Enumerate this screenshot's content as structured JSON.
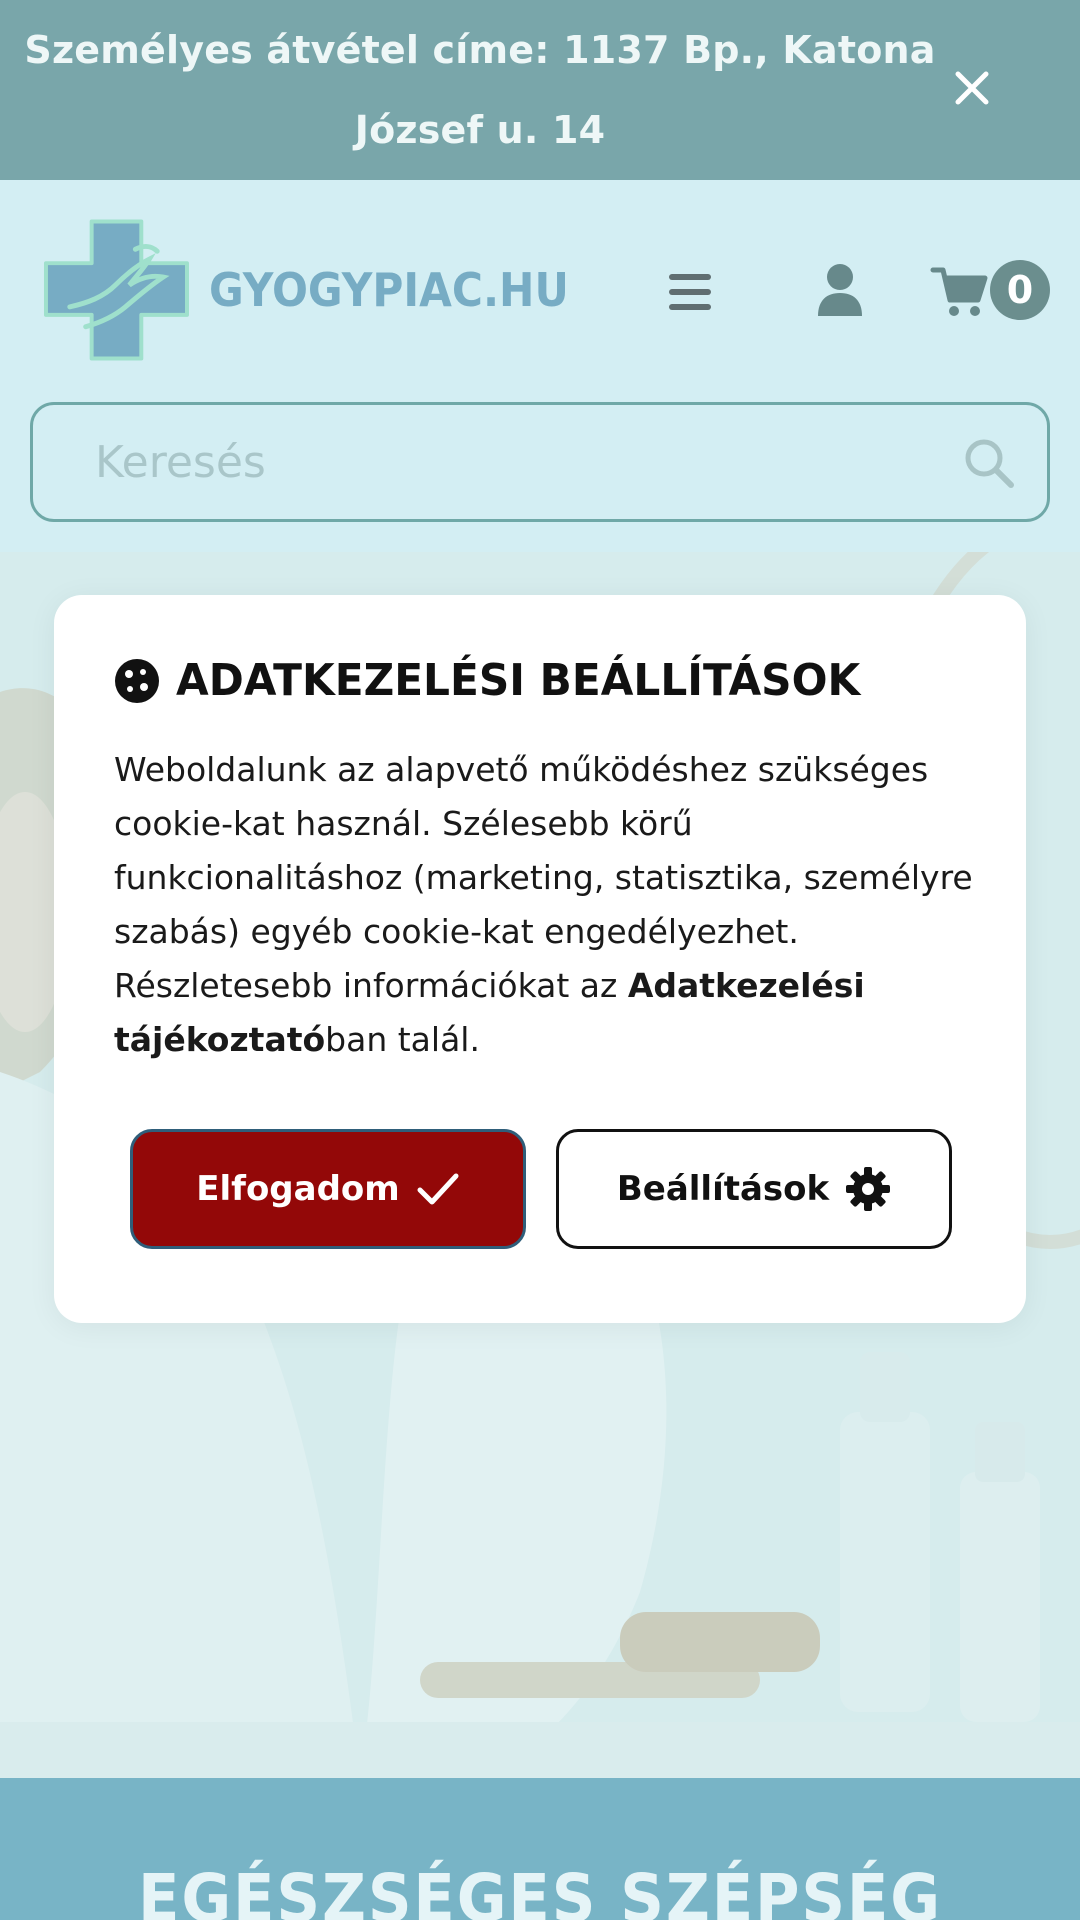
{
  "announcement": {
    "text": "Személyes átvétel címe: 1137 Bp., Katona József u. 14"
  },
  "header": {
    "logo_text": "GYOGYPIAC.HU",
    "cart_count": "0"
  },
  "search": {
    "placeholder": "Keresés"
  },
  "cookie_modal": {
    "title": "ADATKEZELÉSI BEÁLLÍTÁSOK",
    "body_text": "Weboldalunk az alapvető működéshez szükséges cookie-kat használ. Szélesebb körű funkcionalitáshoz (marketing, statisztika, személyre szabás) egyéb cookie-kat engedélyezhet. Részletesebb információkat az ",
    "body_link": "Adatkezelési tájékoztató",
    "body_suffix": "ban talál.",
    "accept_label": "Elfogadom",
    "settings_label": "Beállítások"
  },
  "banner": {
    "title": "EGÉSZSÉGES SZÉPSÉG"
  },
  "colors": {
    "topbar": "#79a6aa",
    "header_bg": "#d3eef3",
    "logo_blue": "#77acc4",
    "accept_red": "#930808",
    "banner": "#78b4c6"
  }
}
